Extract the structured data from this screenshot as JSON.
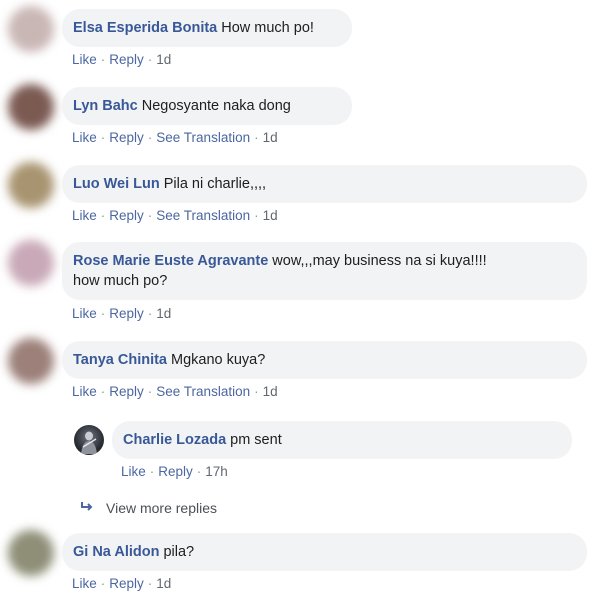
{
  "actions": {
    "like": "Like",
    "reply": "Reply",
    "translate": "See Translation",
    "sep": "·"
  },
  "comments": [
    {
      "name": "Elsa Esperida Bonita",
      "text": "How much po!",
      "time": "1d",
      "avatar_color": "#c9b7b5"
    },
    {
      "name": "Lyn Bahc",
      "text": "Negosyante naka dong",
      "time": "1d",
      "avatar_color": "#7b5a52"
    },
    {
      "name": "Luo Wei Lun",
      "text": "Pila ni charlie,,,,",
      "time": "1d",
      "avatar_color": "#a89470"
    },
    {
      "name": "Rose Marie Euste Agravante",
      "text": "wow,,,may business na si kuya!!!!",
      "text2": "how much po?",
      "time": "1d",
      "avatar_color": "#c9a9b8"
    },
    {
      "name": "Tanya Chinita",
      "text": "Mgkano kuya?",
      "time": "1d",
      "avatar_color": "#9c8079"
    },
    {
      "name": "Gi Na Alidon",
      "text": "pila?",
      "time": "1d",
      "avatar_color": "#8f8f78"
    }
  ],
  "reply": {
    "name": "Charlie Lozada",
    "text": "pm sent",
    "time": "17h",
    "avatar_icon": "guitar-player-icon"
  },
  "view_more": {
    "label": "View more replies",
    "icon": "reply-arrow-icon"
  }
}
